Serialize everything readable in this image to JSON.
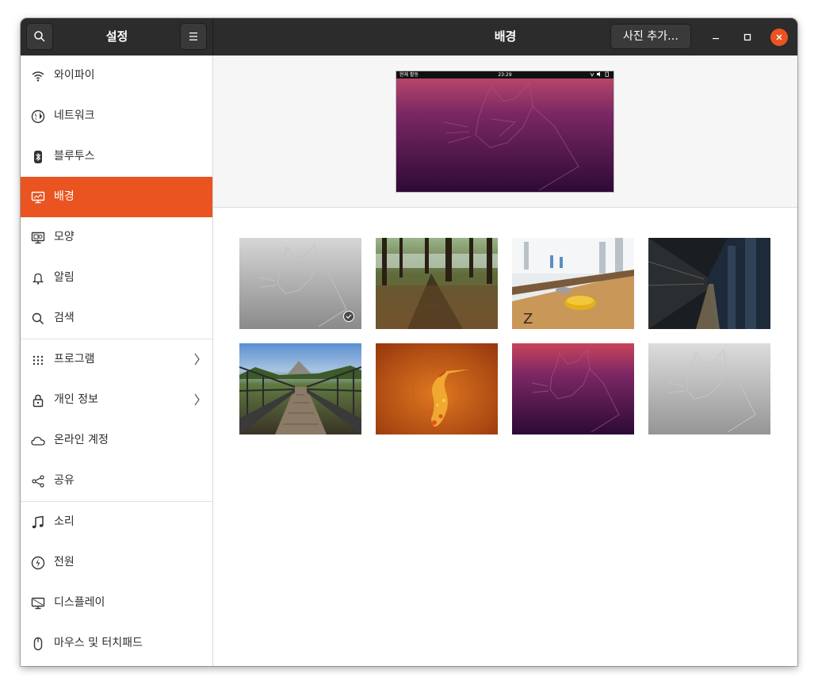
{
  "titlebar": {
    "left_title": "설정",
    "main_title": "배경",
    "add_photo_label": "사진 추가…",
    "search_icon": "search-icon",
    "menu_icon": "hamburger-menu-icon"
  },
  "sidebar": {
    "items": [
      {
        "label": "와이파이",
        "icon": "wifi-icon"
      },
      {
        "label": "네트워크",
        "icon": "globe-icon"
      },
      {
        "label": "블루투스",
        "icon": "bluetooth-icon"
      },
      {
        "label": "배경",
        "icon": "monitor-icon",
        "active": true
      },
      {
        "label": "모양",
        "icon": "appearance-icon"
      },
      {
        "label": "알림",
        "icon": "bell-icon"
      },
      {
        "label": "검색",
        "icon": "search-icon"
      },
      {
        "label": "프로그램",
        "icon": "apps-grid-icon",
        "has_submenu": true
      },
      {
        "label": "개인 정보",
        "icon": "lock-icon",
        "has_submenu": true
      },
      {
        "label": "온라인 계정",
        "icon": "cloud-icon"
      },
      {
        "label": "공유",
        "icon": "share-icon"
      },
      {
        "label": "소리",
        "icon": "music-note-icon"
      },
      {
        "label": "전원",
        "icon": "power-icon"
      },
      {
        "label": "디스플레이",
        "icon": "display-icon"
      },
      {
        "label": "마우스 및 터치패드",
        "icon": "mouse-icon"
      }
    ]
  },
  "preview": {
    "activities_label": "현재 활동",
    "clock": "23:29"
  },
  "wallpapers": [
    {
      "name": "focal-fossa-grey",
      "selected": true
    },
    {
      "name": "forest-shadows"
    },
    {
      "name": "shuffleboard"
    },
    {
      "name": "subway-station"
    },
    {
      "name": "suspension-bridge"
    },
    {
      "name": "orange-bird"
    },
    {
      "name": "focal-fossa-purple"
    },
    {
      "name": "focal-fossa-light-grey"
    }
  ],
  "colors": {
    "accent": "#e95420",
    "titlebar": "#2c2c2c",
    "purple_top": "#a23f6b",
    "purple_bottom": "#2c0a35"
  }
}
